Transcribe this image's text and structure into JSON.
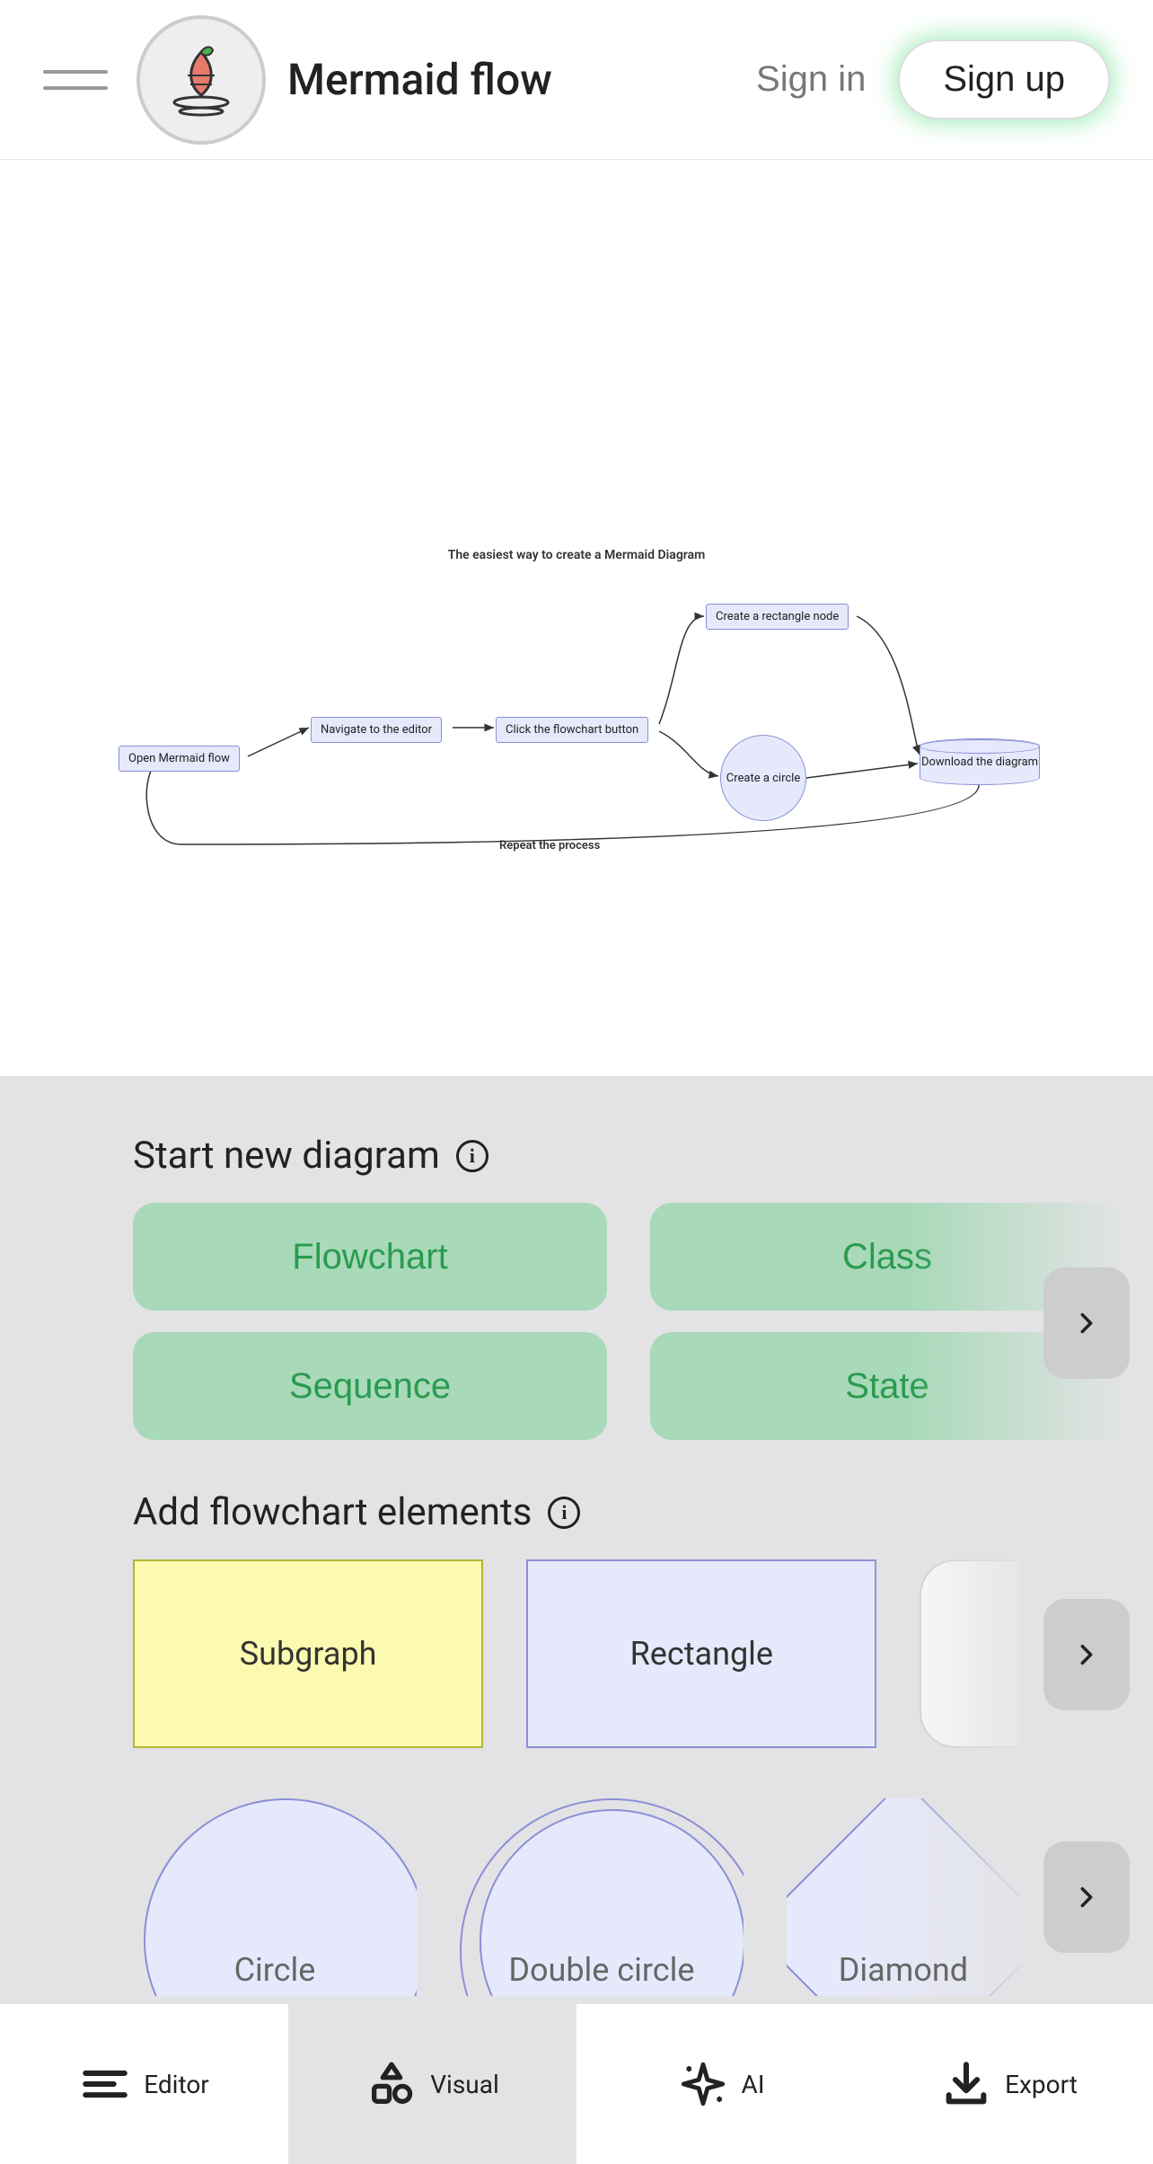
{
  "header": {
    "brand": "Mermaid flow",
    "signin": "Sign in",
    "signup": "Sign up"
  },
  "diagram": {
    "title": "The easiest way to create a Mermaid Diagram",
    "nodes": {
      "open": "Open Mermaid flow",
      "navigate": "Navigate to the editor",
      "click": "Click the flowchart button",
      "rect": "Create a rectangle node",
      "circle": "Create a circle",
      "download": "Download the diagram"
    },
    "edge_label": "Repeat the process"
  },
  "panel": {
    "start_title": "Start new diagram",
    "types": [
      "Flowchart",
      "Class",
      "Sequence",
      "State"
    ],
    "elements_title": "Add flowchart elements",
    "shapes_row1": [
      "Subgraph",
      "Rectangle"
    ],
    "shapes_row2": [
      "Circle",
      "Double circle",
      "Diamond"
    ]
  },
  "tabs": {
    "editor": "Editor",
    "visual": "Visual",
    "ai": "AI",
    "export": "Export"
  }
}
